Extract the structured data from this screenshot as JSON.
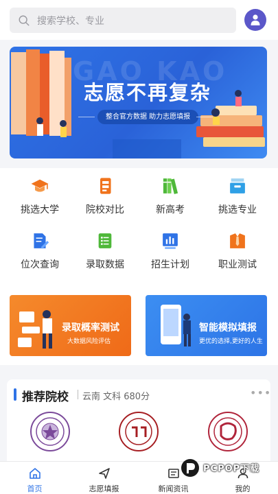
{
  "search": {
    "placeholder": "搜索学校、专业",
    "icon": "search-icon"
  },
  "profile": {
    "icon": "user-icon",
    "color": "#5b57c9"
  },
  "banner": {
    "watermark": "GAO KAO",
    "headline": "志愿不再复杂",
    "subline": "整合官方数据  助力志愿填报"
  },
  "grid": {
    "items": [
      {
        "label": "挑选大学",
        "icon": "graduation-cap-icon"
      },
      {
        "label": "院校对比",
        "icon": "compare-doc-icon"
      },
      {
        "label": "新高考",
        "icon": "books-icon"
      },
      {
        "label": "挑选专业",
        "icon": "inbox-tray-icon"
      },
      {
        "label": "位次查询",
        "icon": "pen-doc-icon"
      },
      {
        "label": "录取数据",
        "icon": "list-doc-icon"
      },
      {
        "label": "招生计划",
        "icon": "bar-chart-icon"
      },
      {
        "label": "职业测试",
        "icon": "shirt-tie-icon"
      }
    ]
  },
  "cards": [
    {
      "title": "录取概率测试",
      "subtitle": "大数据风险评估",
      "color": "#f27b22"
    },
    {
      "title": "智能模拟填报",
      "subtitle": "更优的选择,更好的人生",
      "color": "#3482ee"
    }
  ],
  "recommend": {
    "title": "推荐院校",
    "subtitle": "云南 文科 680分",
    "more": "•••",
    "schools": [
      {
        "icon": "tsinghua-seal-icon",
        "color": "#7b4a9a"
      },
      {
        "icon": "peking-seal-icon",
        "color": "#a61e22"
      },
      {
        "icon": "fudan-seal-icon",
        "color": "#b0243a"
      }
    ]
  },
  "tabs": [
    {
      "label": "首页",
      "icon": "home-icon",
      "active": true
    },
    {
      "label": "志愿填报",
      "icon": "send-icon",
      "active": false
    },
    {
      "label": "新闻资讯",
      "icon": "news-icon",
      "active": false
    },
    {
      "label": "我的",
      "icon": "user-icon",
      "active": false
    }
  ],
  "watermark": {
    "text": "PCPOP下载"
  },
  "colors": {
    "accent": "#2f73e6",
    "orange": "#f27b22"
  }
}
